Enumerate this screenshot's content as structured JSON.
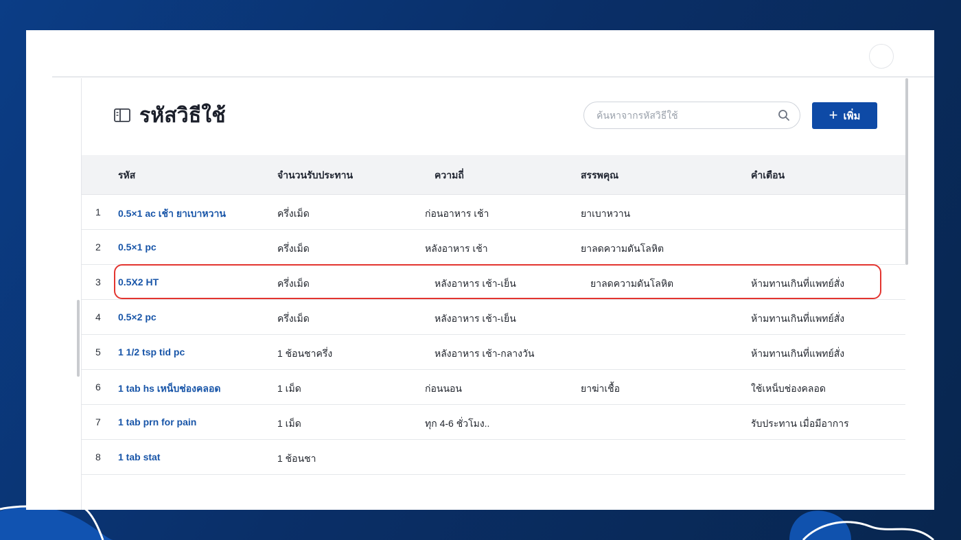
{
  "header": {
    "title": "รหัสวิธีใช้",
    "book_icon": "book-open-icon",
    "search_placeholder": "ค้นหาจากรหัสวิธีใช้",
    "search_icon": "search-icon",
    "add_button_label": "เพิ่ม",
    "add_icon": "plus-icon",
    "accent_color": "#0e4aa6"
  },
  "table": {
    "columns": [
      "รหัส",
      "จำนวนรับประทาน",
      "ความถี่",
      "สรรพคุณ",
      "คำเตือน"
    ],
    "rows": [
      {
        "index": "1",
        "code": "0.5×1 ac เช้า ยาเบาหวาน",
        "dose": "ครึ่งเม็ด",
        "frequency": "ก่อนอาหาร เช้า",
        "indication": "ยาเบาหวาน",
        "warning": ""
      },
      {
        "index": "2",
        "code": "0.5×1 pc",
        "dose": "ครึ่งเม็ด",
        "frequency": "หลังอาหาร เช้า",
        "indication": "ยาลดความดันโลหิต",
        "warning": ""
      },
      {
        "index": "3",
        "code": "0.5X2 HT",
        "dose": "ครึ่งเม็ด",
        "frequency": "หลังอาหาร เช้า-เย็น",
        "indication": "ยาลดความดันโลหิต",
        "warning": "ห้ามทานเกินที่แพทย์สั่ง"
      },
      {
        "index": "4",
        "code": "0.5×2 pc",
        "dose": "ครึ่งเม็ด",
        "frequency": "หลังอาหาร เช้า-เย็น",
        "indication": "",
        "warning": "ห้ามทานเกินที่แพทย์สั่ง"
      },
      {
        "index": "5",
        "code": "1 1/2 tsp tid pc",
        "dose": "1 ช้อนชาครึ่ง",
        "frequency": "หลังอาหาร เช้า-กลางวัน",
        "indication": "",
        "warning": "ห้ามทานเกินที่แพทย์สั่ง"
      },
      {
        "index": "6",
        "code": "1 tab hs เหน็บช่องคลอด",
        "dose": "1 เม็ด",
        "frequency": "ก่อนนอน",
        "indication": "ยาฆ่าเชื้อ",
        "warning": "ใช้เหน็บช่องคลอด"
      },
      {
        "index": "7",
        "code": "1 tab prn for pain",
        "dose": "1 เม็ด",
        "frequency": "ทุก 4-6 ชั่วโมง..",
        "indication": "",
        "warning": "รับประทาน เมื่อมีอาการ"
      },
      {
        "index": "8",
        "code": "1 tab stat",
        "dose": "1 ช้อนชา",
        "frequency": "",
        "indication": "",
        "warning": ""
      }
    ],
    "highlighted_row_index": "3",
    "highlight_color": "#e3342f"
  }
}
